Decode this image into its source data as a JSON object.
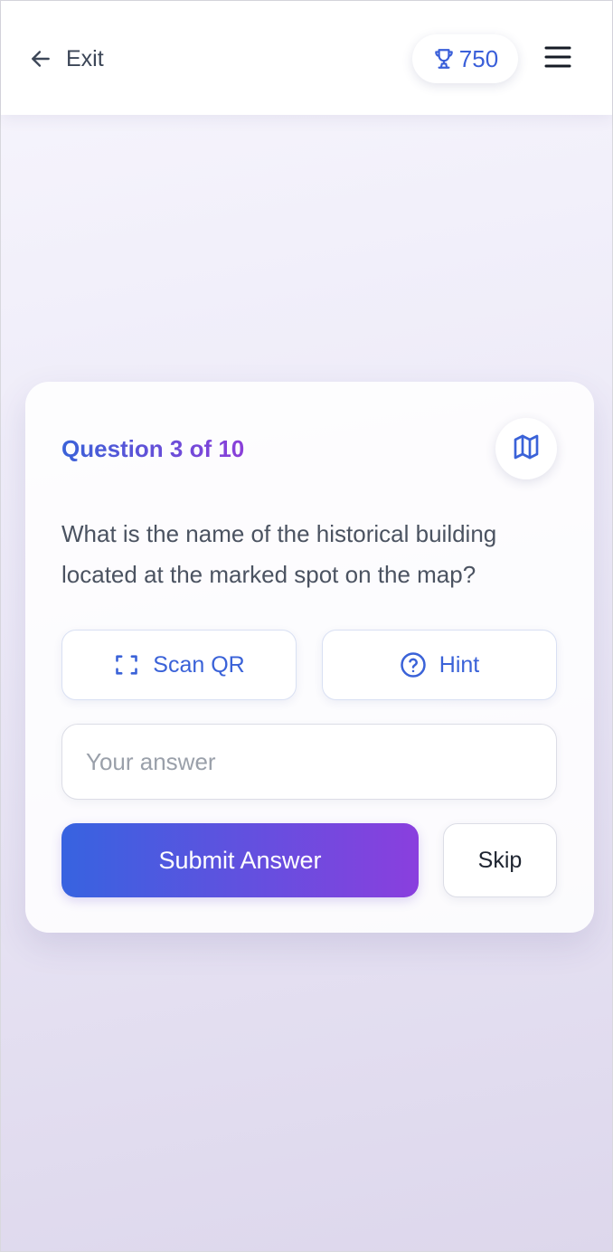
{
  "header": {
    "exit_label": "Exit",
    "exit_icon": "arrow-left-icon",
    "score": "750",
    "score_icon": "trophy-icon",
    "menu_icon": "hamburger-menu-icon"
  },
  "quiz": {
    "question_counter": "Question 3 of 10",
    "map_icon": "map-icon",
    "question_text": "What is the name of the historical building located at the marked spot on the map?",
    "scan_label": "Scan QR",
    "scan_icon": "scan-qr-icon",
    "hint_label": "Hint",
    "hint_icon": "question-circle-icon",
    "answer_placeholder": "Your answer",
    "answer_value": "",
    "submit_label": "Submit Answer",
    "skip_label": "Skip"
  },
  "colors": {
    "accent_blue": "#3a62d8",
    "accent_purple": "#8b3fd9",
    "text_dark": "#1e2430",
    "text_body": "#4b5361"
  }
}
